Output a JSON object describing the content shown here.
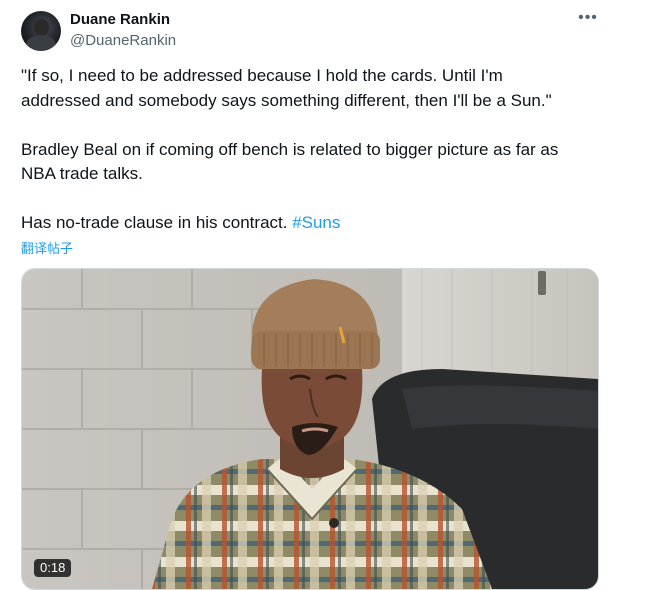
{
  "author": {
    "name": "Duane Rankin",
    "handle": "@DuaneRankin"
  },
  "more_icon": "ellipsis-icon",
  "tweet": {
    "lines": [
      "\"If so, I need to be addressed because I hold the cards. Until I'm",
      "addressed and somebody says something different, then I'll be a Sun.\"",
      "Bradley Beal on if coming off bench is related to bigger picture as far as",
      "NBA trade talks.",
      "Has no-trade clause in his contract. "
    ],
    "hashtag": "#Suns",
    "translate": "翻译帖子"
  },
  "media": {
    "type": "video",
    "duration": "0:18"
  },
  "colors": {
    "link": "#1d9bf0",
    "text": "#0f1419",
    "secondary": "#536471"
  }
}
